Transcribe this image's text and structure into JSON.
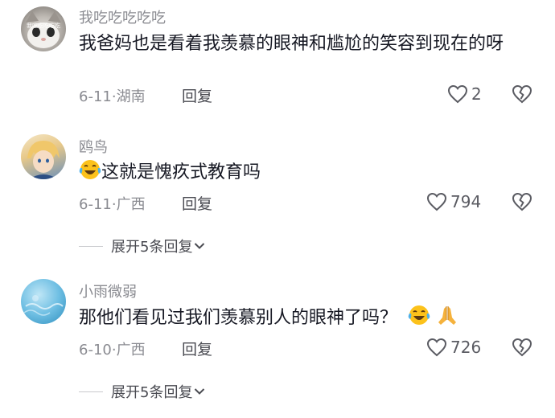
{
  "comments": [
    {
      "username": "我吃吃吃吃吃",
      "avatar_badge": "我吃吃吃吃吃",
      "text": "我爸妈也是看着我羡慕的眼神和尴尬的笑容到现在的呀",
      "date": "6-11",
      "location": "湖南",
      "reply_label": "回复",
      "likes": "2"
    },
    {
      "username": "鸥鸟",
      "text": "这就是愧疚式教育吗",
      "date": "6-11",
      "location": "广西",
      "reply_label": "回复",
      "likes": "794",
      "expand_label": "展开5条回复"
    },
    {
      "username": "小雨微弱",
      "text": "那他们看见过我们羡慕别人的眼神了吗？",
      "date": "6-10",
      "location": "广西",
      "reply_label": "回复",
      "likes": "726",
      "expand_label": "展开5条回复"
    }
  ],
  "separator": "·",
  "colors": {
    "text": "#161823",
    "muted": "#8a8b91",
    "icon": "#5a5b62"
  }
}
